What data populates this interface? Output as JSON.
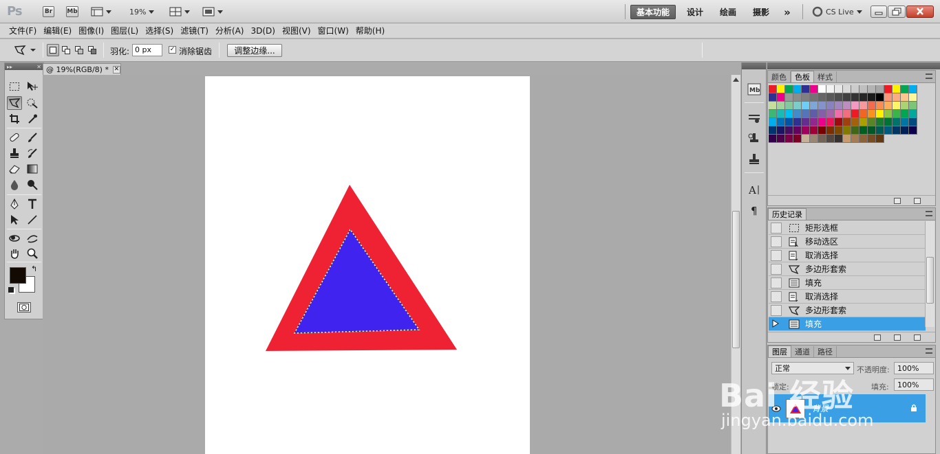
{
  "app": {
    "logo": "Ps",
    "bridge_label": "Br",
    "mini_bridge_label": "Mb",
    "zoom": "19%",
    "workspaces": [
      "基本功能",
      "设计",
      "绘画",
      "摄影"
    ],
    "more_workspaces": "»",
    "cs_live": "CS Live"
  },
  "menu": [
    "文件(F)",
    "编辑(E)",
    "图像(I)",
    "图层(L)",
    "选择(S)",
    "滤镜(T)",
    "分析(A)",
    "3D(D)",
    "视图(V)",
    "窗口(W)",
    "帮助(H)"
  ],
  "options": {
    "feather_label": "羽化:",
    "feather_value": "0 px",
    "antialias_label": "消除锯齿",
    "antialias_checked": true,
    "refine_edge_button": "调整边缘..."
  },
  "document": {
    "tab_title": "@ 19%(RGB/8) *",
    "outer_triangle_color": "#ee2233",
    "inner_triangle_color": "#4123ef"
  },
  "toolbox": {
    "foreground_color": "#140a04",
    "background_color": "#ffffff"
  },
  "panels": {
    "color_tabs": [
      "颜色",
      "色板",
      "样式"
    ],
    "color_active": "色板",
    "swatch_colors": [
      "#ed1c24",
      "#fff200",
      "#00a651",
      "#00aeef",
      "#2e3192",
      "#ec008c",
      "#ffffff",
      "#f2f2f2",
      "#e6e6e6",
      "#d9d9d9",
      "#cccccc",
      "#bfbfbf",
      "#b3b3b3",
      "#a6a6a6",
      "#ed1c24",
      "#fff200",
      "#00a651",
      "#00aeef",
      "#2e3192",
      "#ec008c",
      "#999999",
      "#8c8c8c",
      "#808080",
      "#737373",
      "#666666",
      "#595959",
      "#4d4d4d",
      "#404040",
      "#333333",
      "#262626",
      "#1a1a1a",
      "#000000",
      "#f7977a",
      "#fbad82",
      "#fdc68c",
      "#fff79a",
      "#c4df9b",
      "#a3d39c",
      "#82ca9d",
      "#7bcdc8",
      "#6ecff6",
      "#7ea7d8",
      "#8493ca",
      "#8882be",
      "#a187be",
      "#bc8dbf",
      "#f49ac2",
      "#f6989d",
      "#f26c4f",
      "#f68e56",
      "#fbaf5d",
      "#fff468",
      "#acd372",
      "#7cc576",
      "#3bb878",
      "#1abbb4",
      "#00bff3",
      "#438ccb",
      "#5574b9",
      "#605ca8",
      "#855fa8",
      "#a763a8",
      "#f06ea9",
      "#f26d7d",
      "#ed1c24",
      "#f26522",
      "#f7941d",
      "#fff200",
      "#8dc63f",
      "#39b54a",
      "#00a651",
      "#00a99d",
      "#00aeef",
      "#0072bc",
      "#0054a6",
      "#2e3192",
      "#662d91",
      "#92278f",
      "#ec008c",
      "#ed145b",
      "#9e0b0f",
      "#a0410d",
      "#a3620a",
      "#aba000",
      "#598527",
      "#1a7b30",
      "#007236",
      "#00746b",
      "#0076a3",
      "#004b80",
      "#003471",
      "#1b1464",
      "#440e62",
      "#630460",
      "#9e005d",
      "#9e0039",
      "#790000",
      "#7b2e00",
      "#7d4900",
      "#827b00",
      "#406618",
      "#005e20",
      "#005826",
      "#005952",
      "#005b7f",
      "#003663",
      "#002157",
      "#0d004c",
      "#32004b",
      "#4b0049",
      "#7b0046",
      "#7a0026",
      "#c7b299",
      "#998675",
      "#736357",
      "#534741",
      "#37302d",
      "#c69c6d",
      "#a67c52",
      "#8c6239",
      "#754c24",
      "#603913"
    ],
    "history_tab": "历史记录",
    "history_items": [
      {
        "label": "矩形选框",
        "icon": "rect-marquee-icon"
      },
      {
        "label": "移动选区",
        "icon": "move-selection-icon"
      },
      {
        "label": "取消选择",
        "icon": "deselect-icon"
      },
      {
        "label": "多边形套索",
        "icon": "polygon-lasso-icon"
      },
      {
        "label": "填充",
        "icon": "fill-icon"
      },
      {
        "label": "取消选择",
        "icon": "deselect-icon"
      },
      {
        "label": "多边形套索",
        "icon": "polygon-lasso-icon"
      },
      {
        "label": "填充",
        "icon": "fill-icon"
      }
    ],
    "history_selected_index": 7,
    "layers_tabs": [
      "图层",
      "通道",
      "路径"
    ],
    "blend_mode": "正常",
    "opacity_label": "不透明度:",
    "opacity_value": "100%",
    "lock_label": "锁定:",
    "fill_label": "填充:",
    "fill_value": "100%",
    "layer_name": "背景"
  },
  "watermark": {
    "brand": "Bai 经验",
    "url": "jingyan.baidu.com"
  }
}
